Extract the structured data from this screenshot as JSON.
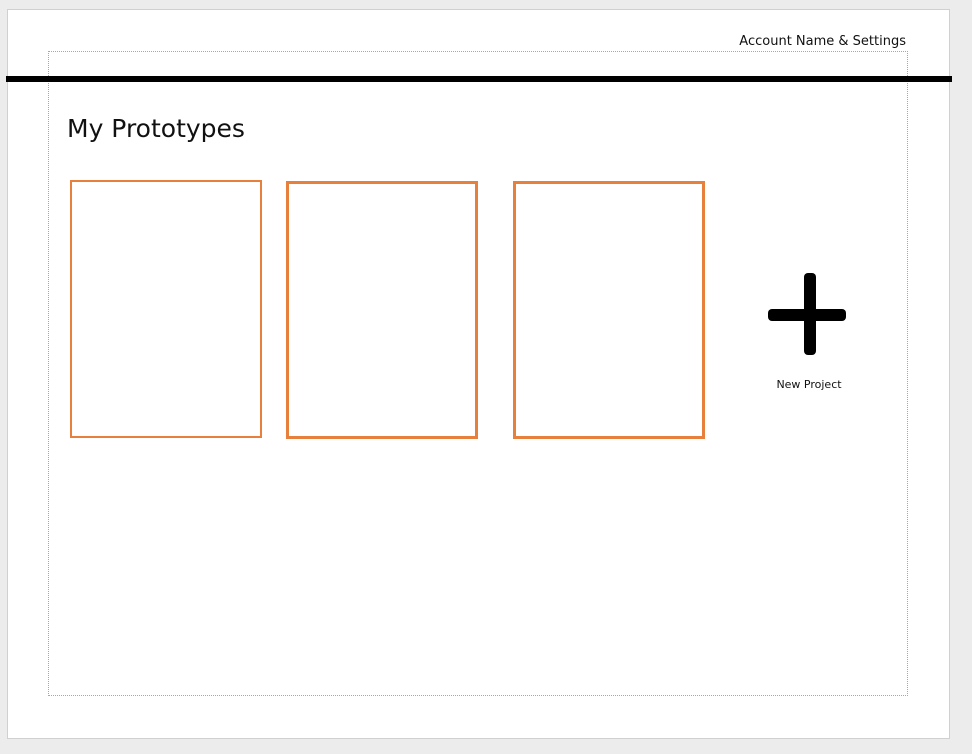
{
  "header": {
    "account_label": "Account Name & Settings"
  },
  "main": {
    "title": "My Prototypes",
    "prototypes": [
      {
        "label": ""
      },
      {
        "label": ""
      },
      {
        "label": ""
      }
    ],
    "new_project": {
      "label": "New Project",
      "icon": "plus-icon"
    }
  },
  "colors": {
    "card_border": "#e8803d",
    "header_rule": "#000000",
    "guide": "#7fb2d8"
  }
}
